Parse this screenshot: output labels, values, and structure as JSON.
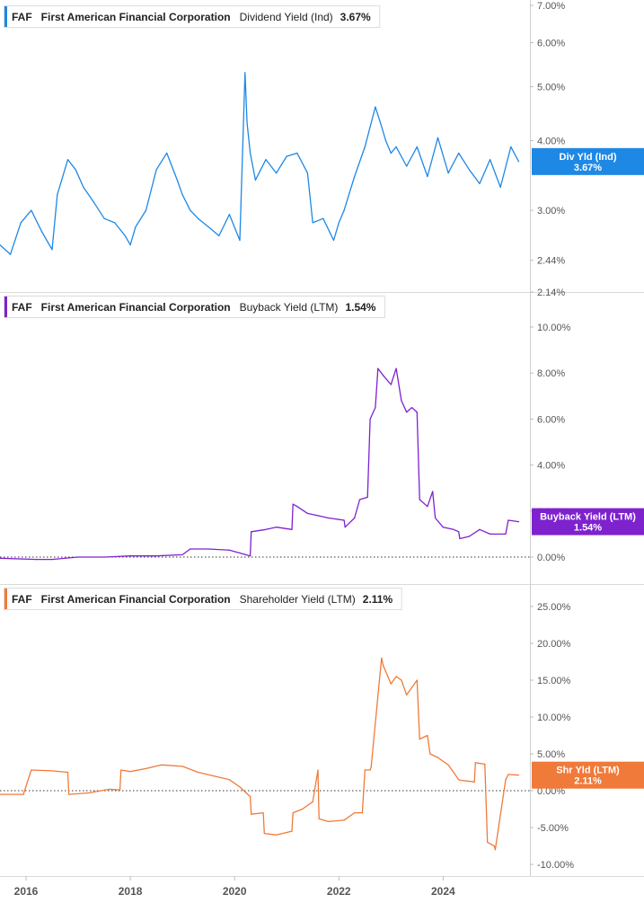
{
  "chart_data": [
    {
      "type": "line",
      "ticker": "FAF",
      "company": "First American Financial Corporation",
      "metric": "Dividend Yield (Ind)",
      "legend_value": "3.67%",
      "badge_label": "Div Yld (Ind)",
      "badge_value": "3.67%",
      "color": "#1e88e5",
      "scale": "log",
      "ylim": [
        2.14,
        7.0
      ],
      "yticks": [
        2.14,
        2.44,
        3.0,
        4.0,
        5.0,
        6.0,
        7.0
      ],
      "ytick_labels": [
        "2.14%",
        "2.44%",
        "3.00%",
        "4.00%",
        "5.00%",
        "6.00%",
        "7.00%"
      ],
      "zero_line": false,
      "x": [
        2015.5,
        2015.7,
        2015.9,
        2016.1,
        2016.3,
        2016.5,
        2016.6,
        2016.8,
        2016.95,
        2017.1,
        2017.3,
        2017.5,
        2017.7,
        2017.9,
        2018.0,
        2018.1,
        2018.3,
        2018.5,
        2018.7,
        2018.9,
        2019.0,
        2019.15,
        2019.3,
        2019.5,
        2019.7,
        2019.9,
        2020.1,
        2020.2,
        2020.24,
        2020.3,
        2020.4,
        2020.6,
        2020.8,
        2021.0,
        2021.2,
        2021.4,
        2021.5,
        2021.7,
        2021.9,
        2022.0,
        2022.1,
        2022.3,
        2022.5,
        2022.7,
        2022.8,
        2022.9,
        2023.0,
        2023.1,
        2023.3,
        2023.5,
        2023.7,
        2023.9,
        2024.1,
        2024.3,
        2024.5,
        2024.7,
        2024.9,
        2025.1,
        2025.3,
        2025.45
      ],
      "values": [
        2.6,
        2.5,
        2.85,
        3.0,
        2.75,
        2.55,
        3.2,
        3.7,
        3.55,
        3.3,
        3.1,
        2.9,
        2.85,
        2.7,
        2.6,
        2.8,
        3.0,
        3.55,
        3.8,
        3.4,
        3.2,
        3.0,
        2.9,
        2.8,
        2.7,
        2.95,
        2.65,
        5.3,
        4.3,
        3.8,
        3.4,
        3.7,
        3.5,
        3.75,
        3.8,
        3.5,
        2.85,
        2.9,
        2.65,
        2.85,
        3.0,
        3.45,
        3.9,
        4.6,
        4.3,
        4.0,
        3.8,
        3.9,
        3.6,
        3.9,
        3.45,
        4.05,
        3.5,
        3.8,
        3.55,
        3.35,
        3.7,
        3.3,
        3.9,
        3.67
      ]
    },
    {
      "type": "line",
      "ticker": "FAF",
      "company": "First American Financial Corporation",
      "metric": "Buyback Yield (LTM)",
      "legend_value": "1.54%",
      "badge_label": "Buyback Yield (LTM)",
      "badge_value": "1.54%",
      "color": "#7e22ce",
      "scale": "linear",
      "ylim": [
        0.0,
        10.0
      ],
      "yticks": [
        0.0,
        2.0,
        4.0,
        6.0,
        8.0,
        10.0
      ],
      "ytick_labels": [
        "0.00%",
        "2.00%",
        "4.00%",
        "6.00%",
        "8.00%",
        "10.00%"
      ],
      "zero_line": true,
      "x": [
        2015.5,
        2016.2,
        2016.5,
        2017.0,
        2017.5,
        2018.0,
        2018.5,
        2019.0,
        2019.15,
        2019.5,
        2019.9,
        2020.3,
        2020.32,
        2020.6,
        2020.8,
        2021.1,
        2021.12,
        2021.2,
        2021.4,
        2021.6,
        2021.8,
        2022.1,
        2022.12,
        2022.3,
        2022.4,
        2022.55,
        2022.6,
        2022.7,
        2022.75,
        2022.85,
        2023.0,
        2023.1,
        2023.2,
        2023.3,
        2023.4,
        2023.5,
        2023.55,
        2023.7,
        2023.8,
        2023.85,
        2024.0,
        2024.2,
        2024.3,
        2024.32,
        2024.5,
        2024.7,
        2024.9,
        2025.2,
        2025.25,
        2025.45
      ],
      "values": [
        -0.05,
        -0.1,
        -0.1,
        0.0,
        0.0,
        0.05,
        0.05,
        0.1,
        0.35,
        0.35,
        0.3,
        0.05,
        1.1,
        1.2,
        1.3,
        1.2,
        2.3,
        2.2,
        1.9,
        1.8,
        1.7,
        1.6,
        1.3,
        1.7,
        2.5,
        2.6,
        6.0,
        6.5,
        8.2,
        7.9,
        7.5,
        8.2,
        6.8,
        6.3,
        6.5,
        6.3,
        2.5,
        2.2,
        2.85,
        1.7,
        1.3,
        1.2,
        1.1,
        0.8,
        0.9,
        1.2,
        1.0,
        1.0,
        1.6,
        1.54
      ]
    },
    {
      "type": "line",
      "ticker": "FAF",
      "company": "First American Financial Corporation",
      "metric": "Shareholder Yield (LTM)",
      "legend_value": "2.11%",
      "badge_label": "Shr Yld (LTM)",
      "badge_value": "2.11%",
      "color": "#f07a3a",
      "scale": "linear",
      "ylim": [
        -10.0,
        25.0
      ],
      "yticks": [
        -10.0,
        -5.0,
        0.0,
        5.0,
        10.0,
        15.0,
        20.0,
        25.0
      ],
      "ytick_labels": [
        "-10.00%",
        "-5.00%",
        "0.00%",
        "5.00%",
        "10.00%",
        "15.00%",
        "20.00%",
        "25.00%"
      ],
      "zero_line": true,
      "x": [
        2015.5,
        2015.95,
        2016.1,
        2016.5,
        2016.8,
        2016.82,
        2017.2,
        2017.6,
        2017.8,
        2017.82,
        2018.0,
        2018.3,
        2018.6,
        2019.0,
        2019.3,
        2019.6,
        2019.9,
        2020.1,
        2020.3,
        2020.32,
        2020.55,
        2020.57,
        2020.8,
        2021.1,
        2021.12,
        2021.3,
        2021.5,
        2021.6,
        2021.62,
        2021.8,
        2022.1,
        2022.3,
        2022.45,
        2022.5,
        2022.6,
        2022.62,
        2022.82,
        2022.85,
        2023.0,
        2023.1,
        2023.2,
        2023.3,
        2023.5,
        2023.55,
        2023.7,
        2023.75,
        2023.9,
        2024.1,
        2024.3,
        2024.35,
        2024.6,
        2024.62,
        2024.8,
        2024.85,
        2024.98,
        2025.0,
        2025.2,
        2025.25,
        2025.45
      ],
      "values": [
        -0.5,
        -0.5,
        2.8,
        2.7,
        2.5,
        -0.5,
        -0.3,
        0.2,
        0.1,
        2.8,
        2.6,
        3.0,
        3.5,
        3.3,
        2.5,
        2.0,
        1.5,
        0.5,
        -0.8,
        -3.2,
        -3.0,
        -5.8,
        -6.0,
        -5.5,
        -3.0,
        -2.5,
        -1.5,
        2.8,
        -3.8,
        -4.2,
        -4.0,
        -3.0,
        -3.0,
        2.8,
        2.8,
        3.2,
        18.0,
        17.0,
        14.5,
        15.5,
        15.0,
        13.0,
        15.0,
        7.0,
        7.5,
        5.0,
        4.5,
        3.5,
        1.5,
        1.4,
        1.2,
        3.8,
        3.6,
        -7.0,
        -7.5,
        -8.0,
        1.5,
        2.2,
        2.11
      ]
    }
  ],
  "x_axis": {
    "ticks": [
      2016,
      2018,
      2020,
      2022,
      2024
    ],
    "tick_labels": [
      "2016",
      "2018",
      "2020",
      "2022",
      "2024"
    ],
    "range": [
      2015.5,
      2025.7
    ]
  },
  "grid": false,
  "legend_placement": "top-left"
}
